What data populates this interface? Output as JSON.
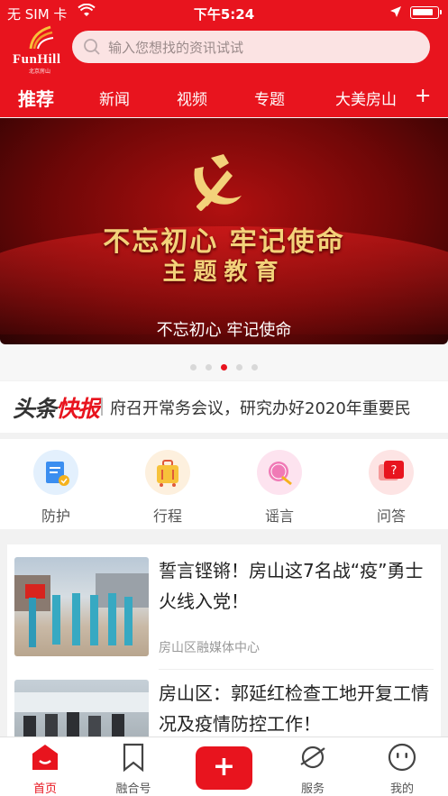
{
  "status_bar": {
    "carrier": "无 SIM 卡",
    "time": "下午5:24",
    "icons": [
      "wifi-icon",
      "location-icon",
      "battery-icon"
    ]
  },
  "header": {
    "logo_text": "FunHill",
    "logo_sub": "北京房山",
    "search_placeholder": "输入您想找的资讯试试"
  },
  "tabs": [
    {
      "label": "推荐",
      "active": true
    },
    {
      "label": "新闻",
      "active": false
    },
    {
      "label": "视频",
      "active": false
    },
    {
      "label": "专题",
      "active": false
    },
    {
      "label": "大美房山",
      "active": false
    }
  ],
  "banner": {
    "line1": "不忘初心 牢记使命",
    "line2": "主题教育",
    "caption": "不忘初心 牢记使命",
    "slide_count": 5,
    "active_slide": 3
  },
  "ticker": {
    "logo_part1": "头条",
    "logo_part2": "快报",
    "text": "府召开常务会议，研究办好2020年重要民"
  },
  "quick_links": [
    {
      "label": "防护",
      "icon": "shield-doc-icon"
    },
    {
      "label": "行程",
      "icon": "luggage-icon"
    },
    {
      "label": "谣言",
      "icon": "rumor-stamp-icon"
    },
    {
      "label": "问答",
      "icon": "question-bubble-icon"
    }
  ],
  "articles": [
    {
      "title": "誓言铿锵！房山这7名战“疫”勇士火线入党！",
      "source": "房山区融媒体中心"
    },
    {
      "title": "房山区：郭延红检查工地开复工情况及疫情防控工作！",
      "source": ""
    }
  ],
  "bottom_nav": [
    {
      "label": "首页",
      "icon": "home-icon",
      "active": true
    },
    {
      "label": "融合号",
      "icon": "bookmark-icon",
      "active": false
    },
    {
      "label": "",
      "icon": "add-icon",
      "active": false
    },
    {
      "label": "服务",
      "icon": "planet-icon",
      "active": false
    },
    {
      "label": "我的",
      "icon": "face-icon",
      "active": false
    }
  ],
  "colors": {
    "brand": "#e8141e",
    "gold": "#f3d27a"
  }
}
